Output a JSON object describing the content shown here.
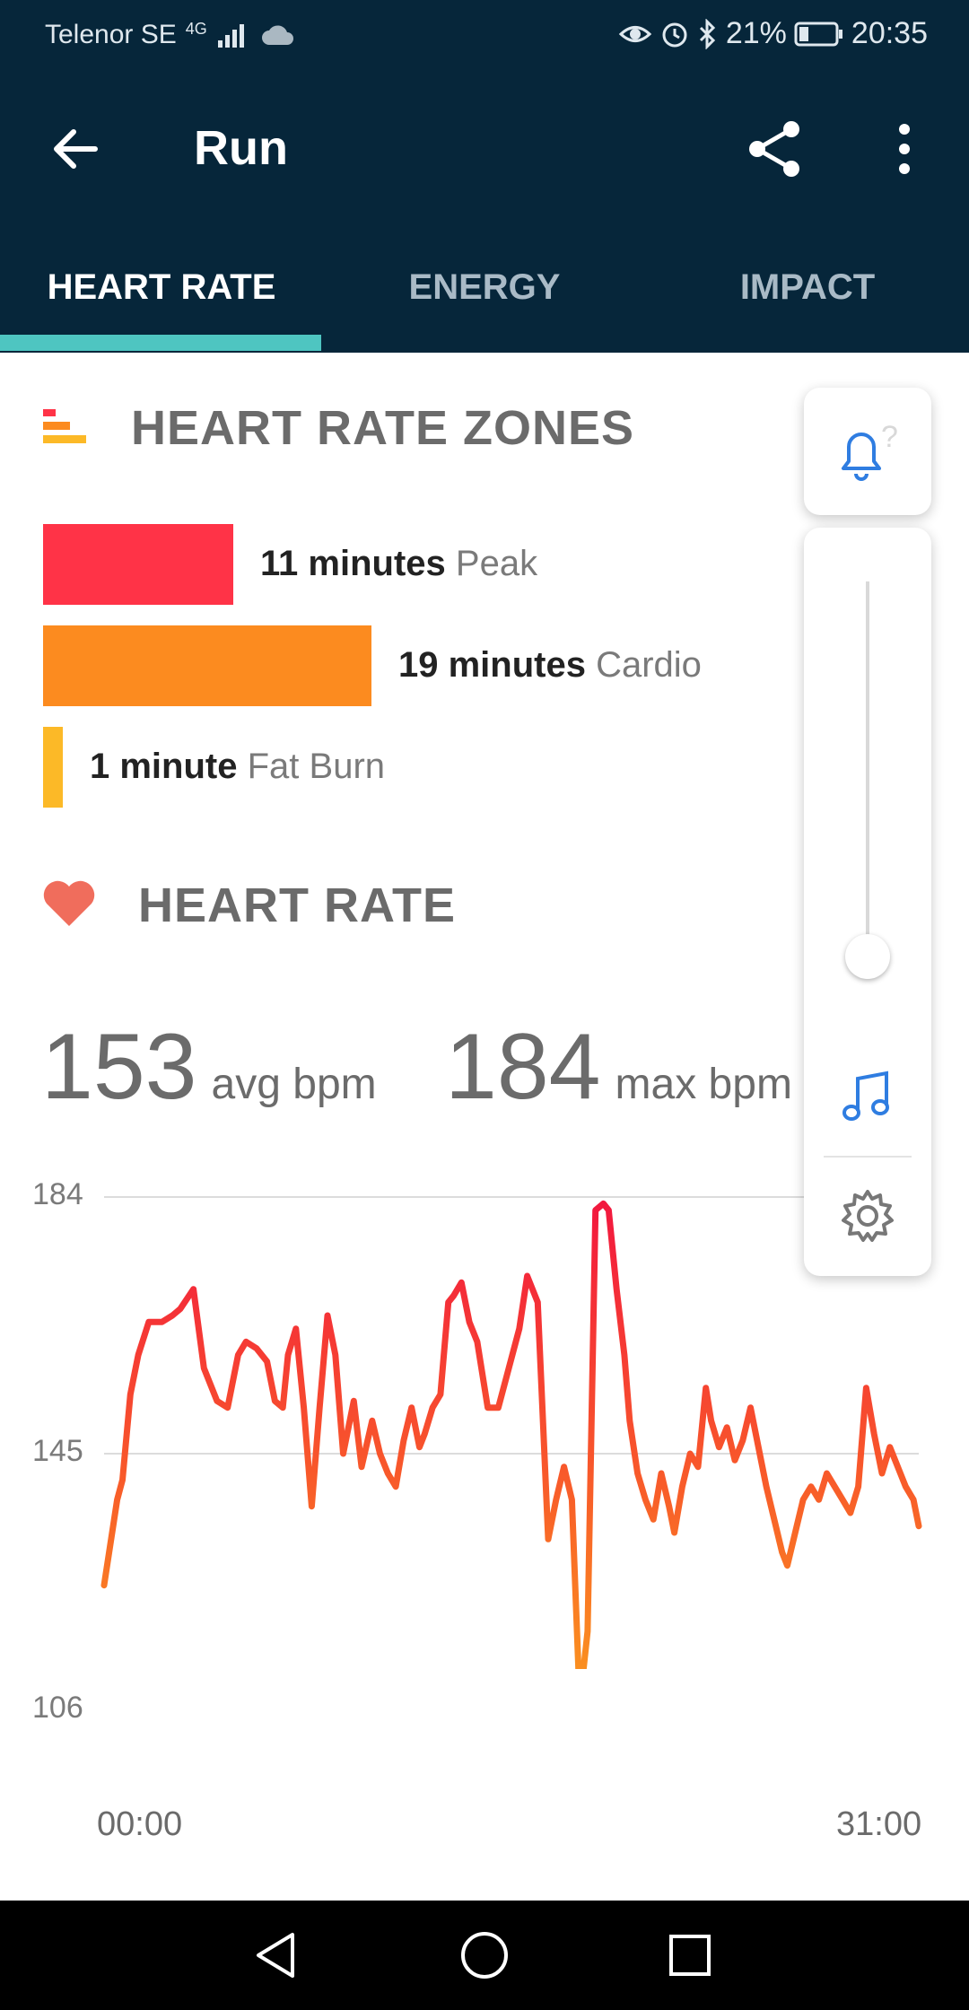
{
  "status_bar": {
    "carrier": "Telenor SE",
    "network": "4G",
    "battery": "21%",
    "time": "20:35"
  },
  "app_bar": {
    "title": "Run",
    "icons": [
      "back-arrow-icon",
      "share-icon",
      "more-vert-icon"
    ]
  },
  "tabs": [
    {
      "label": "HEART RATE",
      "active": true
    },
    {
      "label": "ENERGY",
      "active": false
    },
    {
      "label": "IMPACT",
      "active": false
    }
  ],
  "zones": {
    "title": "HEART RATE ZONES",
    "items": [
      {
        "value": "11 minutes",
        "name": "Peak",
        "color": "#ff3347",
        "minutes": 11
      },
      {
        "value": "19 minutes",
        "name": "Cardio",
        "color": "#fc8b1f",
        "minutes": 19
      },
      {
        "value": "1 minute",
        "name": "Fat Burn",
        "color": "#fcb927",
        "minutes": 1
      }
    ]
  },
  "heart_rate": {
    "title": "HEART RATE",
    "avg_value": "153",
    "avg_unit": "avg bpm",
    "max_value": "184",
    "max_unit": "max bpm"
  },
  "chart_data": {
    "type": "line",
    "title": "",
    "xlabel": "",
    "ylabel": "",
    "x_tick_labels": [
      "00:00",
      "31:00"
    ],
    "y_tick_labels": [
      "184",
      "145",
      "106"
    ],
    "ylim": [
      106,
      184
    ],
    "xlim_minutes": [
      0,
      31
    ],
    "grid": true,
    "series": [
      {
        "x": [
          0,
          0.5,
          0.7,
          1.0,
          1.3,
          1.7,
          2.2,
          2.6,
          2.9,
          3.4,
          3.8,
          4.3,
          4.7,
          5.1,
          5.4,
          5.8,
          6.2,
          6.5,
          6.8,
          7.0,
          7.3,
          7.6,
          7.9,
          8.2,
          8.5,
          8.8,
          9.1,
          9.5,
          9.8,
          10.2,
          10.5,
          10.8,
          11.1,
          11.4,
          11.7,
          12.0,
          12.2,
          12.5,
          12.8,
          13.1,
          13.3,
          13.6,
          13.9,
          14.2,
          14.6,
          15.0,
          15.4,
          15.8,
          16.1,
          16.5,
          16.9,
          17.2,
          17.5,
          17.8,
          18.1,
          18.4,
          18.7,
          19.0,
          19.2,
          19.5,
          19.8,
          20.0,
          20.3,
          20.6,
          20.9,
          21.2,
          21.5,
          21.7,
          22.0,
          22.3,
          22.6,
          22.9,
          23.1,
          23.4,
          23.7,
          24.0,
          24.3,
          24.6,
          24.9,
          25.2,
          25.5,
          25.8,
          26.0,
          26.3,
          26.6,
          26.9,
          27.2,
          27.5,
          27.8,
          28.1,
          28.4,
          28.7,
          29.0,
          29.3,
          29.6,
          29.9,
          30.2,
          30.5,
          30.8,
          31.0
        ],
        "values": [
          125,
          138,
          141,
          154,
          160,
          165,
          165,
          166,
          167,
          170,
          158,
          153,
          152,
          160,
          162,
          161,
          159,
          153,
          152,
          160,
          164,
          152,
          137,
          152,
          166,
          160,
          145,
          153,
          143,
          150,
          145,
          142,
          140,
          147,
          152,
          146,
          148,
          152,
          154,
          168,
          169,
          171,
          165,
          162,
          152,
          152,
          158,
          164,
          172,
          168,
          132,
          138,
          143,
          138,
          107,
          118,
          182,
          183,
          182,
          170,
          160,
          150,
          142,
          138,
          135,
          142,
          137,
          133,
          140,
          145,
          143,
          155,
          150,
          146,
          149,
          144,
          147,
          152,
          146,
          140,
          135,
          130,
          128,
          133,
          138,
          140,
          138,
          142,
          140,
          138,
          136,
          140,
          155,
          148,
          142,
          146,
          143,
          140,
          138,
          134
        ]
      }
    ]
  },
  "side_panel": {
    "icons": [
      "bell-icon",
      "music-note-icon",
      "settings-gear-icon"
    ],
    "volume_level": 0.05
  },
  "nav_bar": {
    "icons": [
      "nav-back-icon",
      "nav-home-icon",
      "nav-recents-icon"
    ]
  }
}
